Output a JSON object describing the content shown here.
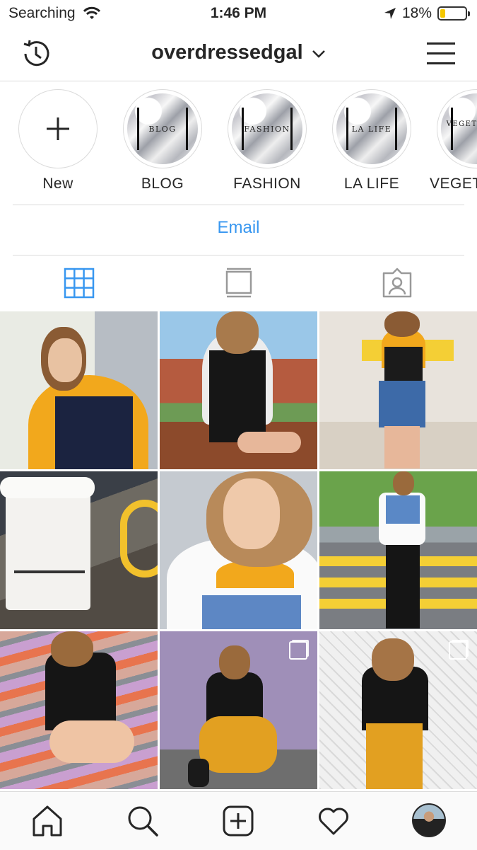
{
  "status_bar": {
    "carrier": "Searching",
    "time": "1:46 PM",
    "battery": "18%",
    "battery_level": 0.18
  },
  "header": {
    "username": "overdressedgal"
  },
  "highlights": [
    {
      "label": "New",
      "cover_text": ""
    },
    {
      "label": "BLOG",
      "cover_text": "BLOG"
    },
    {
      "label": "FASHION",
      "cover_text": "FASHION"
    },
    {
      "label": "LA LIFE",
      "cover_text": "LA LIFE"
    },
    {
      "label": "VEGET",
      "cover_text": "VEGETA FOO"
    }
  ],
  "contact": {
    "email_label": "Email"
  },
  "tabs": [
    "grid-view",
    "feed-view",
    "tagged-view"
  ],
  "grid": [
    {
      "name": "post-1"
    },
    {
      "name": "post-2"
    },
    {
      "name": "post-3"
    },
    {
      "name": "post-4"
    },
    {
      "name": "post-5"
    },
    {
      "name": "post-6"
    },
    {
      "name": "post-7"
    },
    {
      "name": "post-8",
      "multi": true
    },
    {
      "name": "post-9",
      "multi": true
    }
  ],
  "colors": {
    "accent": "#3897f0",
    "border": "#dbdbdb",
    "text": "#262626",
    "battery": "#f5c800"
  }
}
